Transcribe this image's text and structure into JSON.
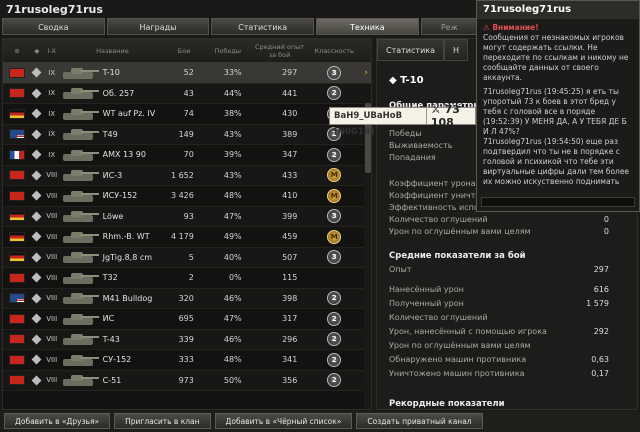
{
  "window": {
    "title": "71rusoleg71rus"
  },
  "tabs": [
    {
      "label": "Сводка",
      "active": false
    },
    {
      "label": "Награды",
      "active": false
    },
    {
      "label": "Статистика",
      "active": false
    },
    {
      "label": "Техника",
      "active": true
    },
    {
      "label": "Реж",
      "active": false
    }
  ],
  "table": {
    "headers": [
      "Название",
      "Бои",
      "Победы",
      "Средний опыт за бой",
      "Классность"
    ],
    "rows": [
      {
        "flag": "ussr",
        "tier": "IX",
        "name": "T-10",
        "battles": "52",
        "wins": "33%",
        "exp": "297",
        "badge": "3",
        "medal": false,
        "selected": true
      },
      {
        "flag": "ussr",
        "tier": "IX",
        "name": "Об. 257",
        "battles": "43",
        "wins": "44%",
        "exp": "441",
        "badge": "2",
        "medal": false,
        "selected": false
      },
      {
        "flag": "germany",
        "tier": "IX",
        "name": "WT auf Pz. IV",
        "battles": "74",
        "wins": "38%",
        "exp": "430",
        "badge": "2",
        "medal": false,
        "selected": false
      },
      {
        "flag": "usa",
        "tier": "IX",
        "name": "T49",
        "battles": "149",
        "wins": "43%",
        "exp": "389",
        "badge": "2",
        "medal": false,
        "selected": false
      },
      {
        "flag": "france",
        "tier": "IX",
        "name": "AMX 13 90",
        "battles": "70",
        "wins": "39%",
        "exp": "347",
        "badge": "2",
        "medal": false,
        "selected": false
      },
      {
        "flag": "ussr",
        "tier": "VIII",
        "name": "ИС-3",
        "battles": "1 652",
        "wins": "43%",
        "exp": "433",
        "badge": "M",
        "medal": true,
        "selected": false
      },
      {
        "flag": "ussr",
        "tier": "VIII",
        "name": "ИСУ-152",
        "battles": "3 426",
        "wins": "48%",
        "exp": "410",
        "badge": "M",
        "medal": true,
        "selected": false
      },
      {
        "flag": "germany",
        "tier": "VIII",
        "name": "Löwe",
        "battles": "93",
        "wins": "47%",
        "exp": "399",
        "badge": "3",
        "medal": false,
        "selected": false
      },
      {
        "flag": "germany",
        "tier": "VIII",
        "name": "Rhm.-B. WT",
        "battles": "4 179",
        "wins": "49%",
        "exp": "459",
        "badge": "M",
        "medal": true,
        "selected": false
      },
      {
        "flag": "germany",
        "tier": "VIII",
        "name": "JgTig.8,8 cm",
        "battles": "5",
        "wins": "40%",
        "exp": "507",
        "badge": "3",
        "medal": false,
        "selected": false
      },
      {
        "flag": "ussr",
        "tier": "VIII",
        "name": "T32",
        "battles": "2",
        "wins": "0%",
        "exp": "115",
        "badge": "",
        "medal": false,
        "selected": false
      },
      {
        "flag": "usa",
        "tier": "VIII",
        "name": "M41 Bulldog",
        "battles": "320",
        "wins": "46%",
        "exp": "398",
        "badge": "2",
        "medal": false,
        "selected": false
      },
      {
        "flag": "ussr",
        "tier": "VIII",
        "name": "ИС",
        "battles": "695",
        "wins": "47%",
        "exp": "317",
        "badge": "2",
        "medal": false,
        "selected": false
      },
      {
        "flag": "ussr",
        "tier": "VIII",
        "name": "T-43",
        "battles": "339",
        "wins": "46%",
        "exp": "296",
        "badge": "2",
        "medal": false,
        "selected": false
      },
      {
        "flag": "ussr",
        "tier": "VIII",
        "name": "СУ-152",
        "battles": "333",
        "wins": "48%",
        "exp": "341",
        "badge": "2",
        "medal": false,
        "selected": false
      },
      {
        "flag": "ussr",
        "tier": "VIII",
        "name": "С-51",
        "battles": "973",
        "wins": "50%",
        "exp": "356",
        "badge": "2",
        "medal": false,
        "selected": false
      }
    ]
  },
  "panel": {
    "tabs": [
      "Статистика",
      "Н"
    ],
    "vehicle": "T-10",
    "general_title": "Общие параметры",
    "general": [
      {
        "label": "Победы",
        "value": ""
      },
      {
        "label": "Выживаемость",
        "value": ""
      },
      {
        "label": "Попадания",
        "value": ""
      },
      {
        "label": "Коэффициент урона",
        "value": ""
      },
      {
        "label": "Коэффициент уничтож",
        "value": ""
      },
      {
        "label": "Эффективность исполь",
        "value": ""
      },
      {
        "label": "Количество оглушений",
        "value": "0"
      },
      {
        "label": "Урон по оглушённым вами целям",
        "value": "0"
      }
    ],
    "avg_title": "Средние показатели за бой",
    "avg": [
      {
        "label": "Опыт",
        "value": "297"
      },
      {
        "label": "Нанесённый урон",
        "value": "616"
      },
      {
        "label": "Полученный урон",
        "value": "1 579"
      },
      {
        "label": "Количество оглушений",
        "value": ""
      },
      {
        "label": "Урон, нанесённый с помощью игрока",
        "value": "292"
      },
      {
        "label": "Урон по оглушённым вами целям",
        "value": ""
      },
      {
        "label": "Обнаружено машин противника",
        "value": "0,63"
      },
      {
        "label": "Уничтожено машин противника",
        "value": "0,17"
      }
    ],
    "records_title": "Рекордные показатели"
  },
  "tooltip": {
    "clan": "BaH9_UBaHoB [N0G1B]",
    "score": "73 108"
  },
  "chat": {
    "title": "71rusoleg71rus",
    "warning": "Внимание!",
    "warning_text": "Сообщения от незнакомых игроков могут содержать ссылки. Не переходите по ссылкам и никому не сообщайте данных от своего аккаунта.",
    "messages": [
      {
        "text": "71rusoleg71rus (19:45:25) я еть ты упоротый 73 к боев в этот бред у тебя с головой все в поряде"
      },
      {
        "text": "(19:52:39) У МЕНЯ ДА, А У ТЕБЯ ДЕ Б И Л 47%?"
      },
      {
        "text": "71rusoleg71rus (19:54:50) еще раз подтвердил что ты не в порядке с головой и психикой что тебе эти виртуальные цифры дали тем более их можно искуственно поднимать"
      }
    ]
  },
  "bottom_buttons": [
    "Добавить в «Друзья»",
    "Пригласить в клан",
    "Добавить в «Чёрный список»",
    "Создать приватный канал"
  ]
}
